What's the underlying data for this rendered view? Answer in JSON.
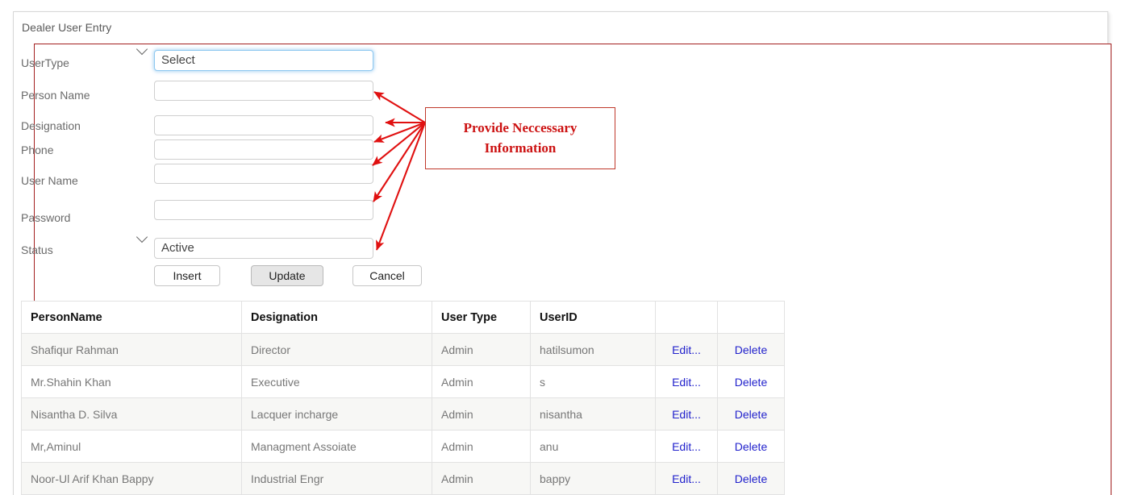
{
  "panel": {
    "title": "Dealer User Entry"
  },
  "form": {
    "fields": [
      {
        "label": "UserType",
        "name": "usertype",
        "type": "select",
        "value": "Select"
      },
      {
        "label": "Person Name",
        "name": "personname",
        "type": "text",
        "value": ""
      },
      {
        "label": "Designation",
        "name": "designation",
        "type": "text",
        "value": ""
      },
      {
        "label": "Phone",
        "name": "phone",
        "type": "text",
        "value": ""
      },
      {
        "label": "User Name",
        "name": "username",
        "type": "text",
        "value": ""
      },
      {
        "label": "Password",
        "name": "password",
        "type": "text",
        "value": ""
      },
      {
        "label": "Status",
        "name": "status",
        "type": "select",
        "value": "Active"
      }
    ],
    "buttons": {
      "insert": "Insert",
      "update": "Update",
      "cancel": "Cancel"
    }
  },
  "annotation": {
    "line1": "Provide Neccessary",
    "line2": "Information",
    "color": "#cc1111",
    "arrow_count": 6
  },
  "table": {
    "headers": [
      "PersonName",
      "Designation",
      "User Type",
      "UserID",
      "",
      ""
    ],
    "edit_label": "Edit...",
    "delete_label": "Delete",
    "rows": [
      {
        "person": "Shafiqur Rahman",
        "designation": "Director",
        "usertype": "Admin",
        "userid": "hatilsumon"
      },
      {
        "person": "Mr.Shahin Khan",
        "designation": "Executive",
        "usertype": "Admin",
        "userid": "s"
      },
      {
        "person": "Nisantha D. Silva",
        "designation": "Lacquer incharge",
        "usertype": "Admin",
        "userid": "nisantha"
      },
      {
        "person": "Mr,Aminul",
        "designation": "Managment Assoiate",
        "usertype": "Admin",
        "userid": "anu"
      },
      {
        "person": "Noor-Ul Arif Khan Bappy",
        "designation": "Industrial Engr",
        "usertype": "Admin",
        "userid": "bappy"
      }
    ]
  },
  "colors": {
    "panel_border": "#d7d7d7",
    "red_border": "#a32020",
    "annotation_red": "#cc1111",
    "link_blue": "#2222cc",
    "focus_blue": "#8ec8f0"
  }
}
